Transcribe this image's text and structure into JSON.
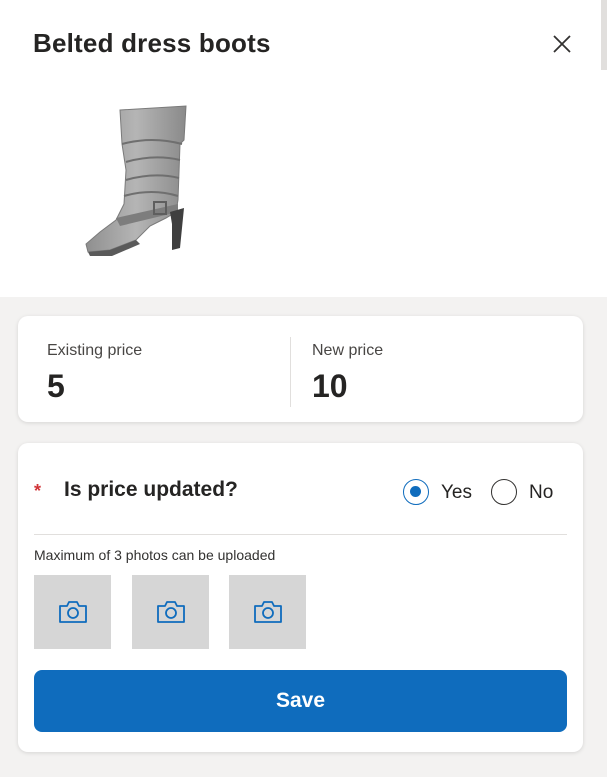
{
  "header": {
    "title": "Belted dress boots",
    "close_icon": "close-icon"
  },
  "product": {
    "image": "boot-image"
  },
  "prices": {
    "existing_label": "Existing price",
    "existing_value": "5",
    "new_label": "New price",
    "new_value": "10"
  },
  "form": {
    "required_marker": "*",
    "question": "Is price updated?",
    "options": [
      {
        "label": "Yes",
        "selected": true
      },
      {
        "label": "No",
        "selected": false
      }
    ],
    "photo_note": "Maximum of 3 photos can be uploaded",
    "photo_slots": 3,
    "photo_icon": "camera-icon",
    "save_label": "Save"
  },
  "colors": {
    "accent": "#0f6cbd",
    "required": "#d13438",
    "photo_slot_bg": "#d6d6d6"
  }
}
